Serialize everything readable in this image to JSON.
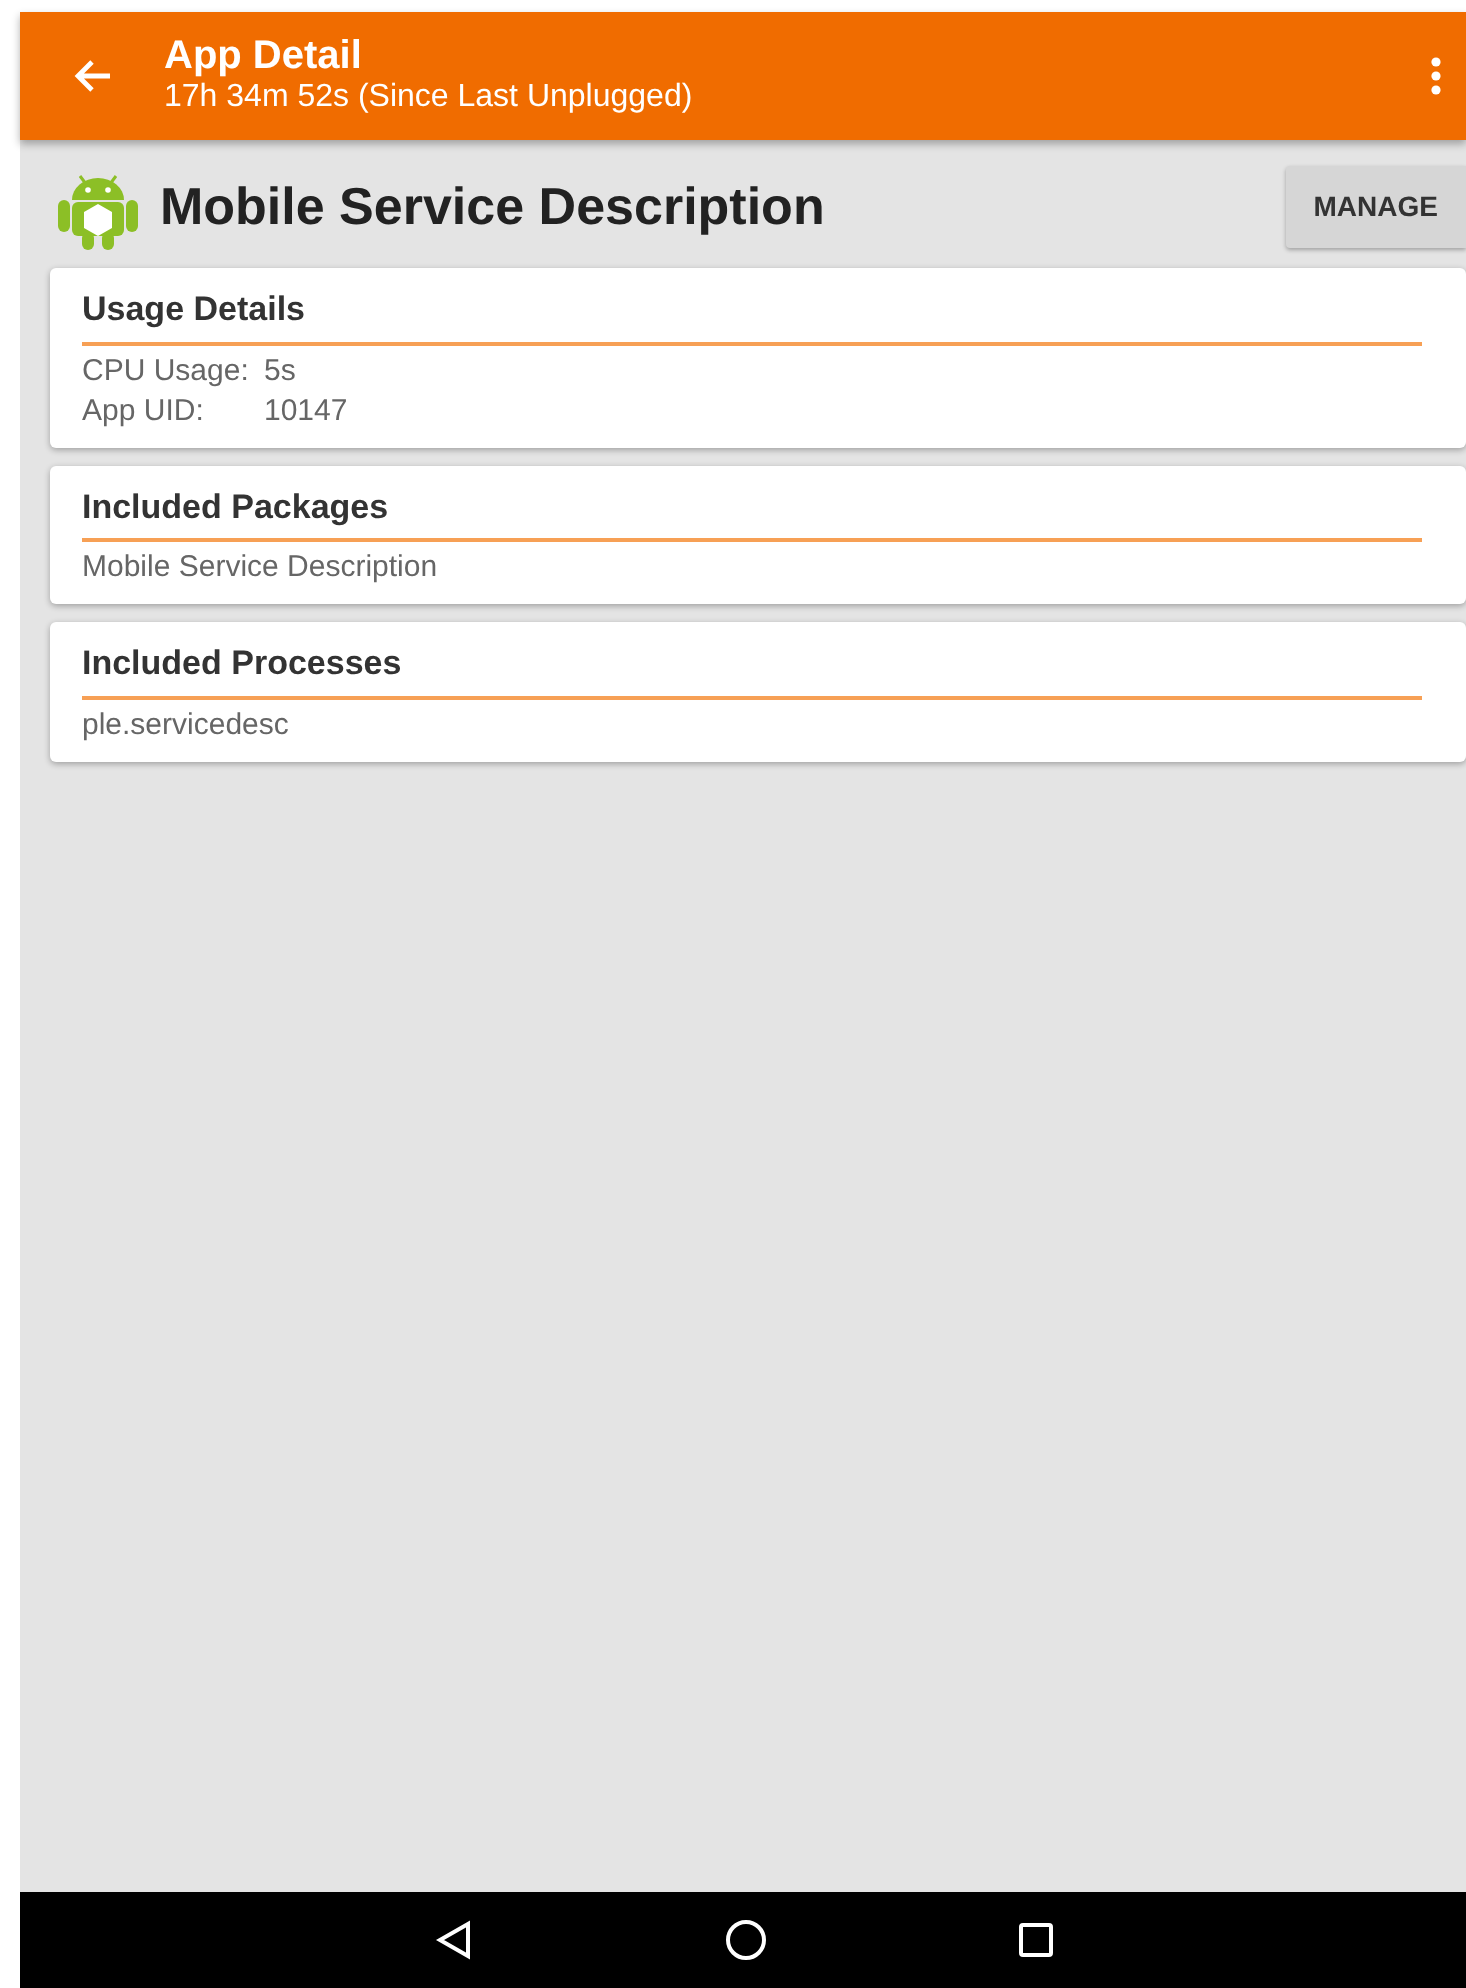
{
  "app_bar": {
    "title": "App Detail",
    "subtitle": "17h 34m 52s (Since Last Unplugged)"
  },
  "header": {
    "app_name": "Mobile Service Description",
    "button": "MANAGE"
  },
  "cards": [
    {
      "title": "Usage Details",
      "kind": "pairs",
      "rows": [
        {
          "label": "CPU Usage:",
          "value": "5s"
        },
        {
          "label": "App UID:",
          "value": "10147"
        }
      ]
    },
    {
      "title": "Included Packages",
      "kind": "lines",
      "rows": [
        {
          "text": "Mobile Service Description"
        }
      ]
    },
    {
      "title": "Included Processes",
      "kind": "lines",
      "rows": [
        {
          "text": "ple.servicedesc"
        }
      ]
    }
  ]
}
